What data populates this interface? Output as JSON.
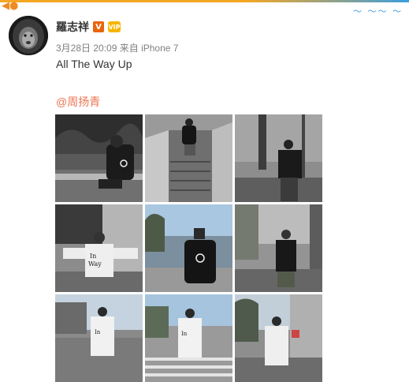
{
  "post": {
    "user_name": "羅志祥",
    "verified_badge": "V",
    "vip_badge": "VIP",
    "timestamp": "3月28日 20:09",
    "source": "来自 iPhone 7",
    "text": "All The Way Up",
    "mention": "@周扬青"
  },
  "icons": {
    "avatar": "lion-avatar-icon",
    "verified": "orange-v-icon",
    "vip": "vip-crown-icon"
  },
  "photos": [
    {
      "name": "photo-1",
      "scene": "garden-sitting"
    },
    {
      "name": "photo-2",
      "scene": "escalator"
    },
    {
      "name": "photo-3",
      "scene": "street-posing"
    },
    {
      "name": "photo-4",
      "scene": "back-arms-open"
    },
    {
      "name": "photo-5",
      "scene": "street-peace-sign"
    },
    {
      "name": "photo-6",
      "scene": "street-standing"
    },
    {
      "name": "photo-7",
      "scene": "street-back-view"
    },
    {
      "name": "photo-8",
      "scene": "crosswalk-back"
    },
    {
      "name": "photo-9",
      "scene": "sidewalk-back"
    }
  ],
  "colors": {
    "accent_orange": "#eb7350",
    "meta_gray": "#808080"
  }
}
